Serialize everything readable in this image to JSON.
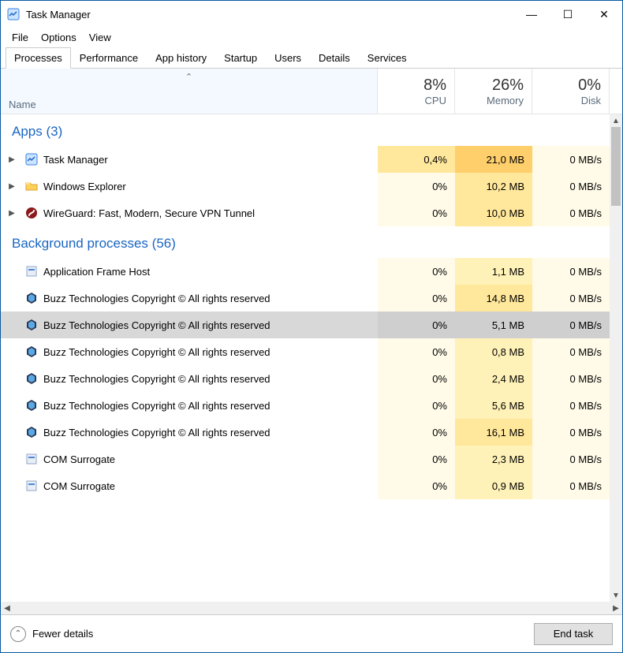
{
  "window": {
    "title": "Task Manager",
    "controls": {
      "min": "—",
      "max": "☐",
      "close": "✕"
    }
  },
  "menu": {
    "file": "File",
    "options": "Options",
    "view": "View"
  },
  "tabs": {
    "processes": "Processes",
    "performance": "Performance",
    "app_history": "App history",
    "startup": "Startup",
    "users": "Users",
    "details": "Details",
    "services": "Services"
  },
  "columns": {
    "name": "Name",
    "cpu": {
      "pct": "8%",
      "label": "CPU"
    },
    "memory": {
      "pct": "26%",
      "label": "Memory"
    },
    "disk": {
      "pct": "0%",
      "label": "Disk"
    }
  },
  "groups": {
    "apps": {
      "title": "Apps (3)"
    },
    "bg": {
      "title": "Background processes (56)"
    }
  },
  "rows": {
    "r0": {
      "name": "Task Manager",
      "cpu": "0,4%",
      "mem": "21,0 MB",
      "disk": "0 MB/s"
    },
    "r1": {
      "name": "Windows Explorer",
      "cpu": "0%",
      "mem": "10,2 MB",
      "disk": "0 MB/s"
    },
    "r2": {
      "name": "WireGuard: Fast, Modern, Secure VPN Tunnel",
      "cpu": "0%",
      "mem": "10,0 MB",
      "disk": "0 MB/s"
    },
    "r3": {
      "name": "Application Frame Host",
      "cpu": "0%",
      "mem": "1,1 MB",
      "disk": "0 MB/s"
    },
    "r4": {
      "name": "Buzz Technologies Copyright © All rights reserved",
      "cpu": "0%",
      "mem": "14,8 MB",
      "disk": "0 MB/s"
    },
    "r5": {
      "name": "Buzz Technologies Copyright © All rights reserved",
      "cpu": "0%",
      "mem": "5,1 MB",
      "disk": "0 MB/s"
    },
    "r6": {
      "name": "Buzz Technologies Copyright © All rights reserved",
      "cpu": "0%",
      "mem": "0,8 MB",
      "disk": "0 MB/s"
    },
    "r7": {
      "name": "Buzz Technologies Copyright © All rights reserved",
      "cpu": "0%",
      "mem": "2,4 MB",
      "disk": "0 MB/s"
    },
    "r8": {
      "name": "Buzz Technologies Copyright © All rights reserved",
      "cpu": "0%",
      "mem": "5,6 MB",
      "disk": "0 MB/s"
    },
    "r9": {
      "name": "Buzz Technologies Copyright © All rights reserved",
      "cpu": "0%",
      "mem": "16,1 MB",
      "disk": "0 MB/s"
    },
    "r10": {
      "name": "COM Surrogate",
      "cpu": "0%",
      "mem": "2,3 MB",
      "disk": "0 MB/s"
    },
    "r11": {
      "name": "COM Surrogate",
      "cpu": "0%",
      "mem": "0,9 MB",
      "disk": "0 MB/s"
    }
  },
  "footer": {
    "fewer": "Fewer details",
    "endtask": "End task"
  }
}
